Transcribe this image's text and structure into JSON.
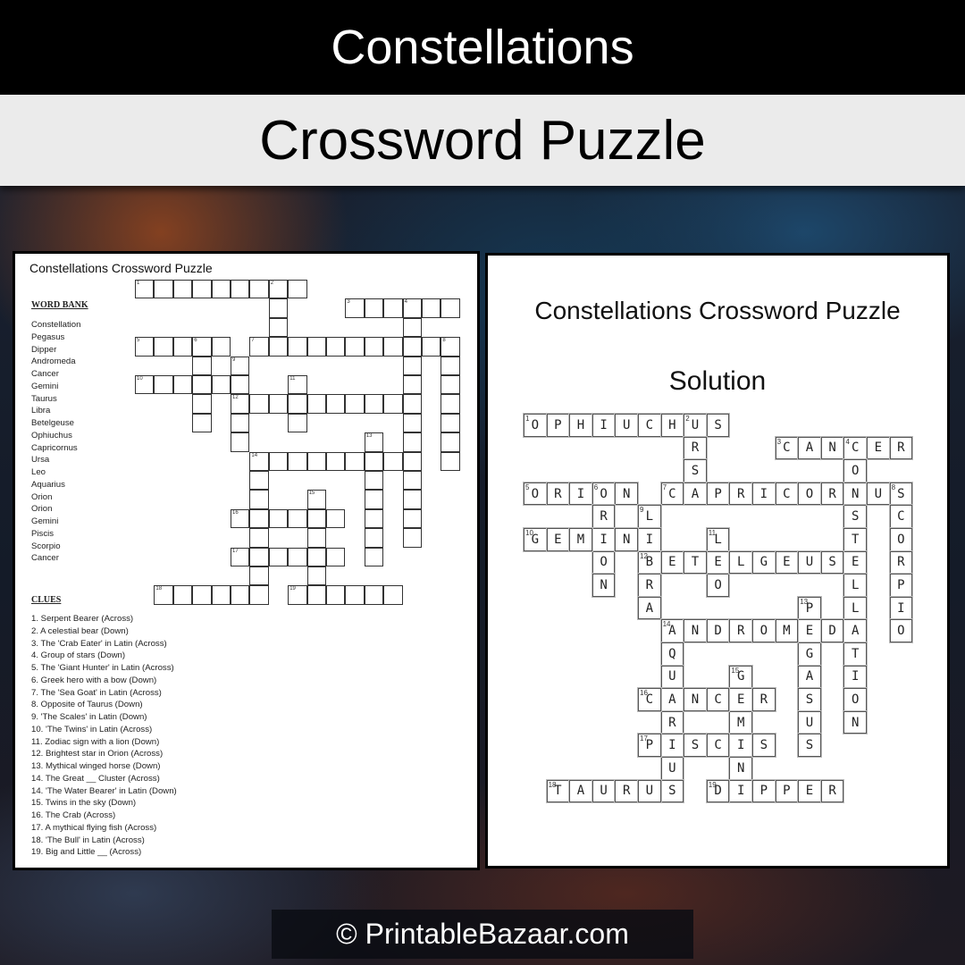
{
  "header": {
    "title": "Constellations",
    "subtitle": "Crossword Puzzle"
  },
  "puzzle_page": {
    "title": "Constellations Crossword Puzzle",
    "word_bank_heading": "WORD BANK",
    "word_bank": [
      "Constellation",
      "Pegasus",
      "Dipper",
      "Andromeda",
      "Cancer",
      "Gemini",
      "Taurus",
      "Libra",
      "Betelgeuse",
      "Ophiuchus",
      "Capricornus",
      "Ursa",
      "Leo",
      "Aquarius",
      "Orion",
      "Orion",
      "Gemini",
      "Piscis",
      "Scorpio",
      "Cancer"
    ],
    "clues_heading": "CLUES",
    "clues": [
      "1. Serpent Bearer (Across)",
      "2. A celestial bear (Down)",
      "3. The 'Crab Eater' in Latin (Across)",
      "4. Group of stars (Down)",
      "5. The 'Giant Hunter' in Latin (Across)",
      "6. Greek hero with a bow (Down)",
      "7. The 'Sea Goat' in Latin (Across)",
      "8. Opposite of Taurus (Down)",
      "9. 'The Scales' in Latin (Down)",
      "10. 'The Twins' in Latin (Across)",
      "11. Zodiac sign with a lion (Down)",
      "12. Brightest star in Orion (Across)",
      "13. Mythical winged horse (Down)",
      "14. The Great __ Cluster (Across)",
      "14. 'The Water Bearer' in Latin (Down)",
      "15. Twins in the sky (Down)",
      "16. The Crab (Across)",
      "17. A mythical flying fish (Across)",
      "18. 'The Bull' in Latin (Across)",
      "19. Big and Little __ (Across)"
    ]
  },
  "solution_page": {
    "title": "Constellations Crossword Puzzle",
    "subtitle": "Solution"
  },
  "crossword": {
    "entries": [
      {
        "num": 1,
        "dir": "across",
        "row": 0,
        "col": 0,
        "answer": "OPHIUCHUS"
      },
      {
        "num": 2,
        "dir": "down",
        "row": 0,
        "col": 7,
        "answer": "URSA"
      },
      {
        "num": 3,
        "dir": "across",
        "row": 1,
        "col": 11,
        "answer": "CANCER"
      },
      {
        "num": 4,
        "dir": "down",
        "row": 1,
        "col": 14,
        "answer": "CONSTELLATION"
      },
      {
        "num": 5,
        "dir": "across",
        "row": 3,
        "col": 0,
        "answer": "ORION"
      },
      {
        "num": 6,
        "dir": "down",
        "row": 3,
        "col": 3,
        "answer": "ORION"
      },
      {
        "num": 7,
        "dir": "across",
        "row": 3,
        "col": 6,
        "answer": "CAPRICORNUS"
      },
      {
        "num": 8,
        "dir": "down",
        "row": 3,
        "col": 16,
        "answer": "SCORPIO"
      },
      {
        "num": 9,
        "dir": "down",
        "row": 4,
        "col": 5,
        "answer": "LIBRA"
      },
      {
        "num": 10,
        "dir": "across",
        "row": 5,
        "col": 0,
        "answer": "GEMINI"
      },
      {
        "num": 11,
        "dir": "down",
        "row": 5,
        "col": 8,
        "answer": "LEO"
      },
      {
        "num": 12,
        "dir": "across",
        "row": 6,
        "col": 5,
        "answer": "BETELGEUSE"
      },
      {
        "num": 13,
        "dir": "down",
        "row": 8,
        "col": 12,
        "answer": "PEGASUS"
      },
      {
        "num": 14,
        "dir": "across",
        "row": 9,
        "col": 6,
        "answer": "ANDROMEDA"
      },
      {
        "num": 14,
        "dir": "down",
        "row": 9,
        "col": 6,
        "answer": "AQUARIUS"
      },
      {
        "num": 15,
        "dir": "down",
        "row": 11,
        "col": 9,
        "answer": "GEMINI"
      },
      {
        "num": 16,
        "dir": "across",
        "row": 12,
        "col": 5,
        "answer": "CANCER"
      },
      {
        "num": 17,
        "dir": "across",
        "row": 14,
        "col": 5,
        "answer": "PISCIS"
      },
      {
        "num": 18,
        "dir": "across",
        "row": 16,
        "col": 1,
        "answer": "TAURUS"
      },
      {
        "num": 19,
        "dir": "across",
        "row": 16,
        "col": 8,
        "answer": "DIPPER"
      }
    ]
  },
  "footer": {
    "text": "© PrintableBazaar.com"
  }
}
